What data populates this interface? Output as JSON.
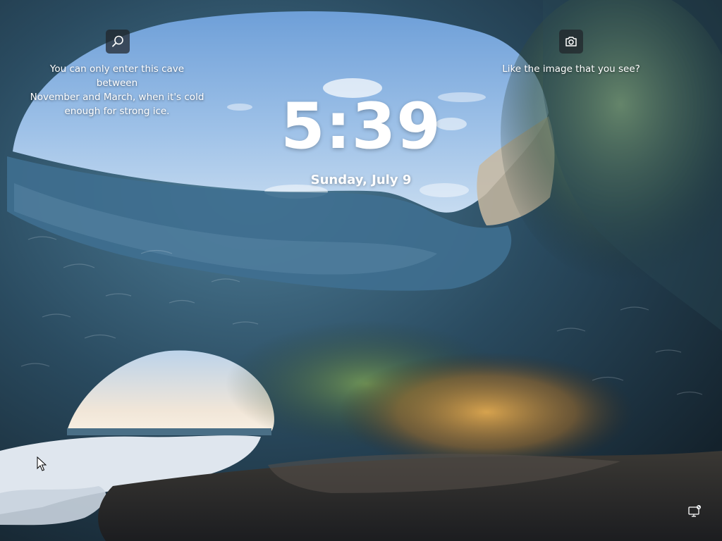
{
  "lockscreen": {
    "time": "5:39",
    "date": "Sunday, July 9"
  },
  "spotlight": {
    "search_icon": "search-icon",
    "camera_icon": "camera-icon",
    "fact_text": "You can only enter this cave between\nNovember and March, when it's cold\nenough for strong ice.",
    "like_prompt": "Like the image that you see?"
  },
  "status": {
    "network_icon": "network-icon"
  },
  "colors": {
    "sky": "#8fb6e3",
    "ice_dark": "#1e3344",
    "glow": "#d8a24a",
    "text": "#ffffff"
  }
}
